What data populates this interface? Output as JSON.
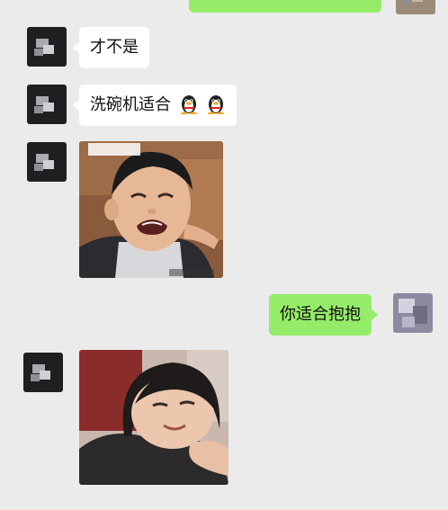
{
  "messages": [
    {
      "side": "right",
      "type": "text",
      "text": ""
    },
    {
      "side": "left",
      "type": "text",
      "text": "才不是"
    },
    {
      "side": "left",
      "type": "text",
      "text": "洗碗机适合",
      "emoji": [
        "penguin-emoji",
        "penguin-emoji"
      ]
    },
    {
      "side": "left",
      "type": "image",
      "image_icon": "crying-child-photo",
      "caption": "…"
    },
    {
      "side": "right",
      "type": "text",
      "text": "你适合抱抱"
    },
    {
      "side": "left",
      "type": "image",
      "image_icon": "smiling-child-photo"
    }
  ],
  "colors": {
    "background": "#ebebec",
    "incoming_bubble": "#ffffff",
    "outgoing_bubble": "#95ec69"
  }
}
